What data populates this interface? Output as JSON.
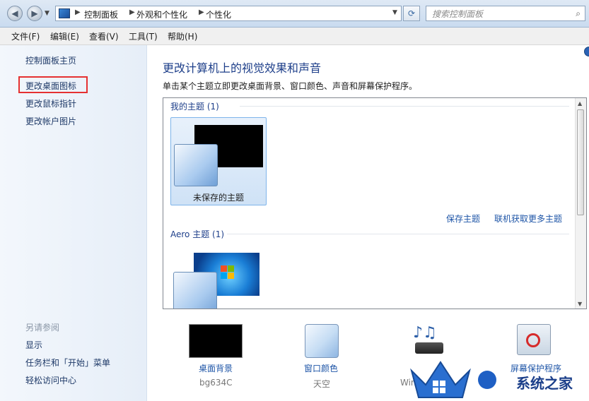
{
  "address": {
    "crumbs": [
      "控制面板",
      "外观和个性化",
      "个性化"
    ]
  },
  "search": {
    "placeholder": "搜索控制面板"
  },
  "menu": [
    "文件(F)",
    "编辑(E)",
    "查看(V)",
    "工具(T)",
    "帮助(H)"
  ],
  "left": {
    "home": "控制面板主页",
    "links": [
      "更改桌面图标",
      "更改鼠标指针",
      "更改帐户图片"
    ],
    "see_also_title": "另请参阅",
    "see_also": [
      "显示",
      "任务栏和「开始」菜单",
      "轻松访问中心"
    ]
  },
  "main": {
    "title": "更改计算机上的视觉效果和声音",
    "desc": "单击某个主题立即更改桌面背景、窗口颜色、声音和屏幕保护程序。",
    "my_themes_header": "我的主题 (1)",
    "unsaved_theme": "未保存的主题",
    "save_theme": "保存主题",
    "get_more": "联机获取更多主题",
    "aero_header": "Aero 主题 (1)"
  },
  "bottom": {
    "bg_label": "桌面背景",
    "bg_value": "bg634C",
    "color_label": "窗口颜色",
    "color_value": "天空",
    "sound_value": "Wind",
    "screensaver_label": "屏幕保护程序"
  },
  "watermark": {
    "text": "系统之家"
  },
  "colors": {
    "accent": "#1e55a7",
    "highlight_box": "#e53131"
  }
}
